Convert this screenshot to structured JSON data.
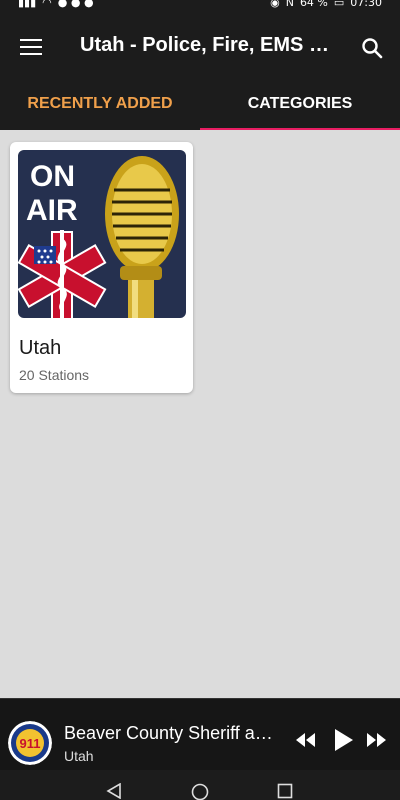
{
  "status_bar": {
    "battery": "64 %",
    "time": "07:30"
  },
  "app_bar": {
    "title": "Utah - Police, Fire, EMS Radio",
    "menu_icon": "hamburger-menu-icon",
    "search_icon": "search-icon"
  },
  "tabs": [
    {
      "label": "RECENTLY ADDED",
      "active": false
    },
    {
      "label": "CATEGORIES",
      "active": true
    }
  ],
  "colors": {
    "accent_orange": "#f0a04b",
    "tab_indicator": "#e91e63",
    "bar_bg": "#1c1c1c",
    "content_bg": "#dcdcdc"
  },
  "categories": [
    {
      "title": "Utah",
      "subtitle": "20 Stations",
      "image": {
        "on_text": "ON",
        "air_text": "AIR"
      }
    }
  ],
  "player": {
    "title": "Beaver County Sheriff and Fire",
    "subtitle": "Utah",
    "logo_text": "911",
    "controls": [
      "rewind-icon",
      "play-icon",
      "fast-forward-icon"
    ]
  },
  "nav_bar": {
    "buttons": [
      "back-icon",
      "home-icon",
      "recents-icon"
    ]
  }
}
